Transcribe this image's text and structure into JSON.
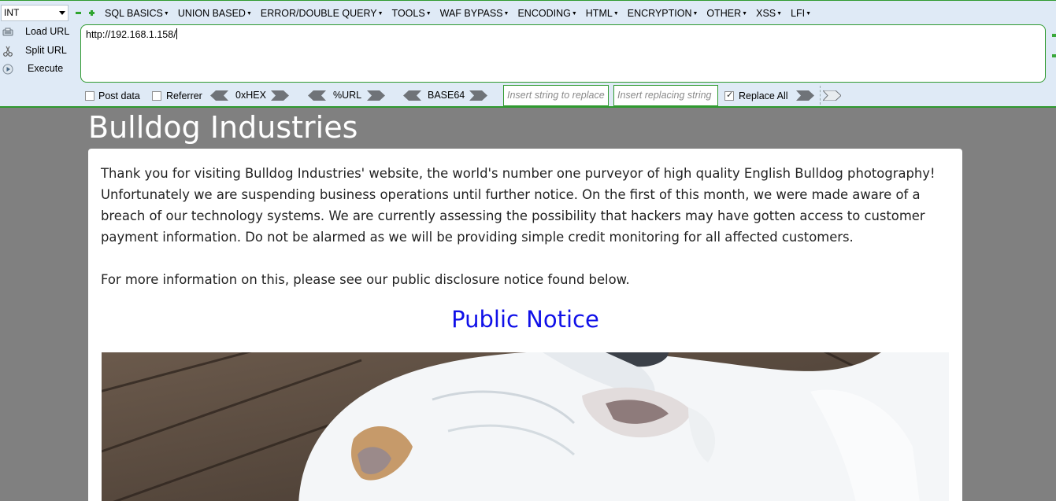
{
  "hackbar": {
    "type_select": "INT",
    "menus": [
      "SQL BASICS",
      "UNION BASED",
      "ERROR/DOUBLE QUERY",
      "TOOLS",
      "WAF BYPASS",
      "ENCODING",
      "HTML",
      "ENCRYPTION",
      "OTHER",
      "XSS",
      "LFI"
    ],
    "actions": {
      "load_url": "Load URL",
      "split_url": "Split URL",
      "execute": "Execute"
    },
    "url_value": "http://192.168.1.158/",
    "options": {
      "post_data": "Post data",
      "referrer": "Referrer",
      "hex": "0xHEX",
      "url_enc": "%URL",
      "base64": "BASE64",
      "replace_placeholder": "Insert string to replace",
      "replacing_placeholder": "Insert replacing string",
      "replace_all": "Replace All",
      "replace_all_checked": true
    },
    "colors": {
      "accent_green": "#2f9a2f",
      "toolbar_bg": "#dfeaf6"
    }
  },
  "page": {
    "title": "Bulldog Industries",
    "paragraph_1": "Thank you for visiting Bulldog Industries' website, the world's number one purveyor of high quality English Bulldog photography! Unfortunately we are suspending business operations until further notice. On the first of this month, we were made aware of a breach of our technology systems. We are currently assessing the possibility that hackers may have gotten access to customer payment information. Do not be alarmed as we will be providing simple credit monitoring for all affected customers.",
    "paragraph_2": "For more information on this, please see our public disclosure notice found below.",
    "notice_heading": "Public Notice",
    "colors": {
      "page_bg": "#808080",
      "link_blue": "#1010e8"
    }
  }
}
